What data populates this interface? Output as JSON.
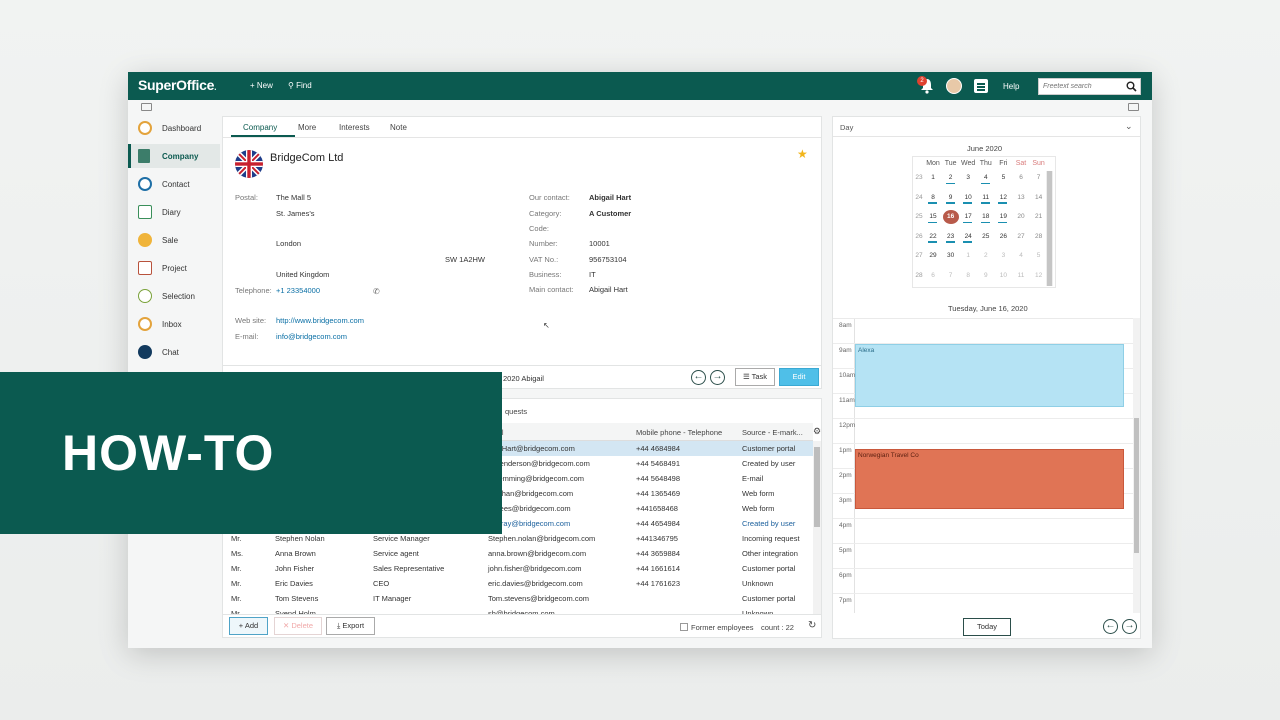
{
  "app": {
    "name": "SuperOffice",
    "dot": "."
  },
  "topbar": {
    "new_label": "+ New",
    "find_label": "Find",
    "notif_count": "2",
    "help_label": "Help",
    "search_placeholder": "Freetext search"
  },
  "sidebar": {
    "items": [
      {
        "label": "Dashboard",
        "icon": "gauge-icon"
      },
      {
        "label": "Company",
        "icon": "company-icon"
      },
      {
        "label": "Contact",
        "icon": "contact-icon"
      },
      {
        "label": "Diary",
        "icon": "calendar-icon"
      },
      {
        "label": "Sale",
        "icon": "sale-icon"
      },
      {
        "label": "Project",
        "icon": "project-icon"
      },
      {
        "label": "Selection",
        "icon": "selection-icon"
      },
      {
        "label": "Inbox",
        "icon": "inbox-icon"
      },
      {
        "label": "Chat",
        "icon": "chat-icon"
      }
    ]
  },
  "company_card": {
    "tabs": [
      "Company",
      "More",
      "Interests",
      "Note"
    ],
    "name": "BridgeCom Ltd",
    "postal_label": "Postal:",
    "address": [
      "The Mall 5",
      "St. James's",
      "London",
      "SW 1A2HW",
      "United Kingdom"
    ],
    "telephone_label": "Telephone:",
    "telephone": "+1 23354000",
    "website_label": "Web site:",
    "website": "http://www.bridgecom.com",
    "email_label": "E-mail:",
    "email": "info@bridgecom.com",
    "our_contact_label": "Our contact:",
    "our_contact": "Abigail Hart",
    "category_label": "Category:",
    "category": "A Customer",
    "code_label": "Code:",
    "number_label": "Number:",
    "number": "10001",
    "vat_label": "VAT No.:",
    "vat": "956753104",
    "business_label": "Business:",
    "business": "IT",
    "main_contact_label": "Main contact:",
    "main_contact": "Abigail Hart"
  },
  "action_bar": {
    "partial_text": "2020    Abigail",
    "task_label": "Task",
    "edit_label": "Edit"
  },
  "grid": {
    "title": "quests",
    "columns": [
      "ail",
      "Mobile phone - Telephone",
      "Source - E-mark..."
    ],
    "rows": [
      {
        "title": "",
        "name": "",
        "role": "",
        "email": "gail.Hart@bridgecom.com",
        "phone": "+44 4684984",
        "source": "Customer portal"
      },
      {
        "title": "",
        "name": "",
        "role": "",
        "email": "a.Henderson@bridgecom.com",
        "phone": "+44 5468491",
        "source": "Created by user"
      },
      {
        "title": "",
        "name": "",
        "role": "",
        "email": "e.hemming@bridgecom.com",
        "phone": "+44 5648498",
        "source": "E-mail"
      },
      {
        "title": "",
        "name": "",
        "role": "",
        "email": "vn.chan@bridgecom.com",
        "phone": "+44 1365469",
        "source": "Web form"
      },
      {
        "title": "",
        "name": "",
        "role": "",
        "email": "n.Rees@bridgecom.com",
        "phone": "+441658468",
        "source": "Web form"
      },
      {
        "title": "",
        "name": "",
        "role": "",
        "email": "murray@bridgecom.com",
        "phone": "+44 4654984",
        "source": "Created by user"
      },
      {
        "title": "Mr.",
        "name": "Stephen Nolan",
        "role": "Service Manager",
        "email": "Stephen.nolan@bridgecom.com",
        "phone": "+441346795",
        "source": "Incoming request"
      },
      {
        "title": "Ms.",
        "name": "Anna Brown",
        "role": "Service agent",
        "email": "anna.brown@bridgecom.com",
        "phone": "+44 3659884",
        "source": "Other integration"
      },
      {
        "title": "Mr.",
        "name": "John Fisher",
        "role": "Sales Representative",
        "email": "john.fisher@bridgecom.com",
        "phone": "+44 1661614",
        "source": "Customer portal"
      },
      {
        "title": "Mr.",
        "name": "Eric Davies",
        "role": "CEO",
        "email": "eric.davies@bridgecom.com",
        "phone": "+44 1761623",
        "source": "Unknown"
      },
      {
        "title": "Mr.",
        "name": "Tom Stevens",
        "role": "IT Manager",
        "email": "Tom.stevens@bridgecom.com",
        "phone": "",
        "source": "Customer portal"
      },
      {
        "title": "Mr.",
        "name": "Svend Holm",
        "role": "",
        "email": "sh@bridgecom.com",
        "phone": "",
        "source": "Unknown"
      }
    ]
  },
  "footer": {
    "add_label": "+ Add",
    "delete_label": "✕ Delete",
    "export_label": "Export",
    "former_label": "Former employees",
    "count_label": "count : 22"
  },
  "calendar": {
    "view": "Day",
    "month_title": "June 2020",
    "weekdays": [
      "Mon",
      "Tue",
      "Wed",
      "Thu",
      "Fri",
      "Sat",
      "Sun"
    ],
    "weeks": [
      {
        "no": "23",
        "days": [
          "1",
          "2",
          "3",
          "4",
          "5",
          "6",
          "7"
        ]
      },
      {
        "no": "24",
        "days": [
          "8",
          "9",
          "10",
          "11",
          "12",
          "13",
          "14"
        ]
      },
      {
        "no": "25",
        "days": [
          "15",
          "16",
          "17",
          "18",
          "19",
          "20",
          "21"
        ]
      },
      {
        "no": "26",
        "days": [
          "22",
          "23",
          "24",
          "25",
          "26",
          "27",
          "28"
        ]
      },
      {
        "no": "27",
        "days": [
          "29",
          "30",
          "1",
          "2",
          "3",
          "4",
          "5"
        ]
      },
      {
        "no": "28",
        "days": [
          "6",
          "7",
          "8",
          "9",
          "10",
          "11",
          "12"
        ]
      }
    ],
    "day_title": "Tuesday, June 16, 2020",
    "hours": [
      "8am",
      "9am",
      "10am",
      "11am",
      "12pm",
      "1pm",
      "2pm",
      "3pm",
      "4pm",
      "5pm",
      "6pm",
      "7pm"
    ],
    "appointments": [
      {
        "title": "Alexa",
        "color": "#b5e3f4"
      },
      {
        "title": "Norwegian Travel Co",
        "color": "#e07455"
      }
    ],
    "today_label": "Today"
  },
  "overlay": {
    "text": "HOW-TO"
  },
  "colors": {
    "brand": "#0b5a50",
    "accent": "#4fbfe8",
    "today": "#b85a4a"
  }
}
